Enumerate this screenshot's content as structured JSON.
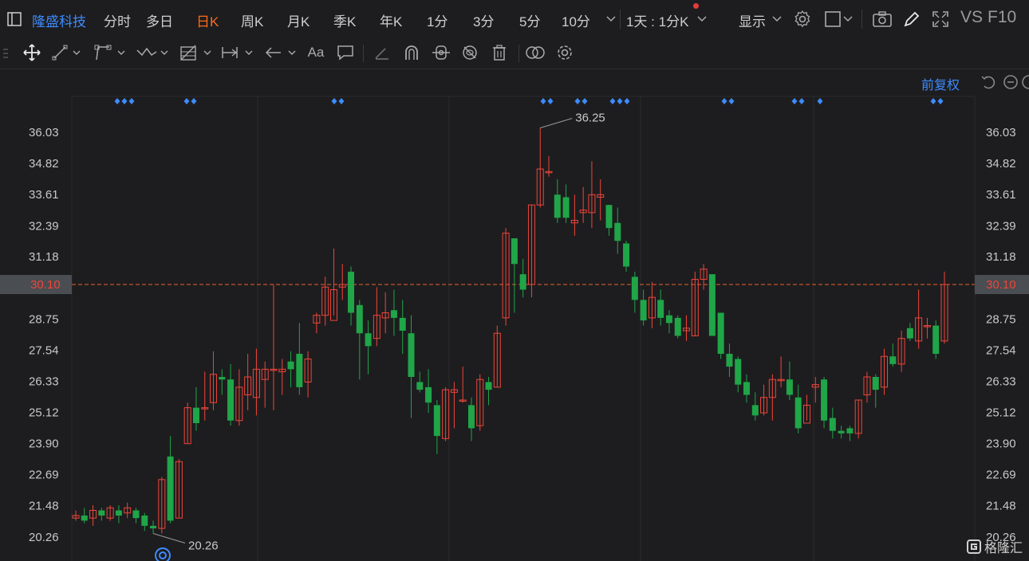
{
  "toolbar": {
    "stock_name": "隆盛科技",
    "periods": [
      "分时",
      "多日",
      "日K",
      "周K",
      "月K",
      "季K",
      "年K",
      "1分",
      "3分",
      "5分",
      "10分"
    ],
    "active_period": "日K",
    "interval_label": "1天 : 1分K",
    "display_label": "显示",
    "vs_label": "VS",
    "f10_label": "F10"
  },
  "chart_header": {
    "adjust_label": "前复权"
  },
  "colors": {
    "up": "#f0453a",
    "down": "#20a548",
    "accent": "#3d8bff",
    "active": "#ff6a1a",
    "price_line": "#e8622c"
  },
  "icons": [
    "move-icon",
    "line-tool-icon",
    "polyline-tool-icon",
    "wave-tool-icon",
    "fib-tool-icon",
    "measure-tool-icon",
    "arrow-tool-icon",
    "text-tool-icon",
    "comment-tool-icon",
    "eraser-icon",
    "magnet-icon",
    "lock-icon",
    "hide-icon",
    "trash-icon",
    "link-icon",
    "settings-icon",
    "camera-icon",
    "pencil-icon",
    "fullscreen-icon"
  ],
  "chart_data": {
    "type": "candlestick",
    "y_ticks": [
      "36.03",
      "34.82",
      "33.61",
      "32.39",
      "31.18",
      "30.10",
      "28.75",
      "27.54",
      "26.33",
      "25.12",
      "23.90",
      "22.69",
      "21.48",
      "20.26"
    ],
    "ylim": [
      19.7,
      37.3
    ],
    "current_price": "30.10",
    "max_label": "36.25",
    "min_label": "20.26",
    "candles": [
      [
        21.0,
        21.1,
        20.9,
        21.3
      ],
      [
        21.1,
        20.9,
        20.8,
        21.4
      ],
      [
        21.0,
        21.3,
        20.7,
        21.5
      ],
      [
        21.3,
        21.1,
        20.9,
        21.4
      ],
      [
        21.0,
        21.4,
        20.9,
        21.5
      ],
      [
        21.3,
        21.1,
        20.8,
        21.5
      ],
      [
        21.2,
        21.4,
        21.0,
        21.6
      ],
      [
        21.3,
        21.0,
        20.8,
        21.4
      ],
      [
        21.1,
        20.7,
        20.5,
        21.2
      ],
      [
        20.7,
        20.6,
        20.4,
        20.9
      ],
      [
        20.6,
        22.5,
        20.4,
        22.6
      ],
      [
        23.4,
        20.9,
        20.8,
        24.2
      ],
      [
        21.0,
        23.2,
        21.0,
        23.3
      ],
      [
        23.9,
        25.3,
        23.9,
        25.5
      ],
      [
        25.3,
        24.7,
        24.4,
        26.1
      ],
      [
        25.3,
        25.3,
        24.8,
        26.7
      ],
      [
        25.5,
        26.6,
        25.2,
        27.5
      ],
      [
        26.5,
        26.4,
        25.8,
        26.8
      ],
      [
        26.4,
        24.8,
        24.6,
        27.0
      ],
      [
        24.8,
        26.1,
        24.6,
        26.8
      ],
      [
        25.8,
        26.5,
        25.2,
        27.4
      ],
      [
        25.7,
        26.8,
        25.0,
        27.6
      ],
      [
        26.4,
        26.8,
        25.3,
        27.1
      ],
      [
        26.8,
        26.8,
        25.2,
        30.1
      ],
      [
        26.7,
        26.8,
        25.8,
        27.2
      ],
      [
        27.1,
        26.8,
        26.1,
        27.5
      ],
      [
        27.4,
        26.1,
        25.8,
        28.6
      ],
      [
        26.3,
        27.2,
        25.7,
        27.5
      ],
      [
        28.6,
        28.9,
        28.2,
        29.0
      ],
      [
        28.9,
        30.0,
        28.5,
        30.4
      ],
      [
        28.7,
        29.9,
        28.9,
        31.5
      ],
      [
        30.0,
        30.1,
        29.5,
        30.9
      ],
      [
        30.6,
        29.0,
        28.5,
        30.8
      ],
      [
        29.3,
        28.2,
        26.4,
        29.5
      ],
      [
        28.2,
        27.7,
        26.6,
        28.7
      ],
      [
        28.0,
        28.9,
        27.7,
        30.0
      ],
      [
        28.8,
        29.0,
        28.2,
        29.8
      ],
      [
        29.1,
        28.8,
        28.1,
        29.9
      ],
      [
        28.8,
        28.3,
        27.4,
        29.5
      ],
      [
        28.2,
        26.5,
        24.9,
        28.9
      ],
      [
        26.3,
        26.0,
        25.9,
        26.7
      ],
      [
        26.1,
        25.5,
        25.1,
        26.8
      ],
      [
        25.4,
        24.2,
        23.5,
        25.6
      ],
      [
        24.1,
        26.0,
        24.0,
        26.1
      ],
      [
        25.9,
        26.0,
        24.5,
        26.3
      ],
      [
        25.6,
        25.6,
        25.5,
        26.9
      ],
      [
        25.4,
        24.5,
        24.0,
        25.7
      ],
      [
        24.6,
        26.4,
        24.4,
        26.6
      ],
      [
        26.3,
        26.0,
        25.4,
        26.5
      ],
      [
        26.1,
        28.2,
        26.1,
        28.5
      ],
      [
        28.8,
        32.1,
        28.5,
        32.3
      ],
      [
        31.9,
        30.9,
        29.0,
        31.9
      ],
      [
        30.5,
        29.9,
        29.6,
        31.1
      ],
      [
        30.1,
        33.2,
        29.6,
        33.2
      ],
      [
        33.2,
        34.6,
        33.1,
        36.2
      ],
      [
        34.5,
        34.5,
        34.3,
        35.1
      ],
      [
        33.6,
        32.7,
        32.5,
        34.2
      ],
      [
        33.5,
        32.7,
        32.5,
        34.0
      ],
      [
        32.5,
        32.6,
        32.0,
        33.6
      ],
      [
        32.9,
        33.0,
        32.5,
        33.9
      ],
      [
        32.9,
        33.6,
        32.3,
        34.9
      ],
      [
        33.5,
        33.6,
        32.6,
        34.2
      ],
      [
        33.2,
        32.3,
        32.0,
        33.2
      ],
      [
        32.5,
        31.8,
        31.3,
        33.1
      ],
      [
        31.7,
        30.8,
        30.6,
        31.8
      ],
      [
        30.4,
        29.5,
        29.0,
        30.6
      ],
      [
        29.5,
        28.7,
        28.5,
        29.9
      ],
      [
        28.8,
        29.6,
        28.4,
        30.2
      ],
      [
        29.5,
        28.8,
        28.5,
        29.9
      ],
      [
        28.9,
        28.6,
        28.2,
        29.1
      ],
      [
        28.8,
        28.1,
        28.0,
        28.9
      ],
      [
        28.3,
        28.4,
        27.9,
        28.9
      ],
      [
        28.1,
        30.3,
        28.1,
        30.6
      ],
      [
        30.3,
        30.7,
        29.9,
        30.9
      ],
      [
        30.5,
        28.1,
        28.1,
        30.5
      ],
      [
        29.0,
        27.4,
        27.2,
        29.0
      ],
      [
        27.4,
        26.9,
        26.5,
        27.8
      ],
      [
        27.2,
        26.2,
        25.9,
        27.3
      ],
      [
        26.3,
        25.8,
        25.5,
        26.6
      ],
      [
        25.4,
        25.0,
        24.8,
        25.9
      ],
      [
        25.1,
        25.7,
        25.0,
        26.2
      ],
      [
        25.7,
        26.4,
        24.8,
        26.6
      ],
      [
        26.4,
        26.4,
        26.1,
        27.3
      ],
      [
        26.4,
        25.8,
        25.6,
        27.1
      ],
      [
        25.7,
        24.5,
        24.3,
        26.2
      ],
      [
        24.7,
        25.4,
        24.8,
        25.8
      ],
      [
        26.1,
        26.2,
        25.5,
        26.5
      ],
      [
        26.4,
        24.8,
        24.5,
        26.5
      ],
      [
        24.9,
        24.4,
        24.1,
        25.3
      ],
      [
        24.4,
        24.3,
        24.1,
        24.6
      ],
      [
        24.5,
        24.3,
        24.0,
        24.6
      ],
      [
        24.3,
        25.6,
        24.1,
        25.6
      ],
      [
        25.8,
        26.5,
        25.5,
        26.7
      ],
      [
        26.5,
        26.0,
        25.3,
        26.6
      ],
      [
        26.1,
        27.3,
        25.8,
        27.6
      ],
      [
        27.3,
        27.0,
        26.9,
        27.8
      ],
      [
        27.0,
        28.0,
        26.7,
        28.3
      ],
      [
        28.4,
        28.0,
        27.9,
        28.6
      ],
      [
        27.9,
        28.8,
        27.6,
        29.9
      ],
      [
        28.5,
        28.5,
        28.0,
        28.8
      ],
      [
        28.5,
        27.4,
        27.2,
        28.7
      ],
      [
        27.9,
        30.1,
        27.8,
        30.6
      ]
    ]
  },
  "watermark": "格隆汇"
}
